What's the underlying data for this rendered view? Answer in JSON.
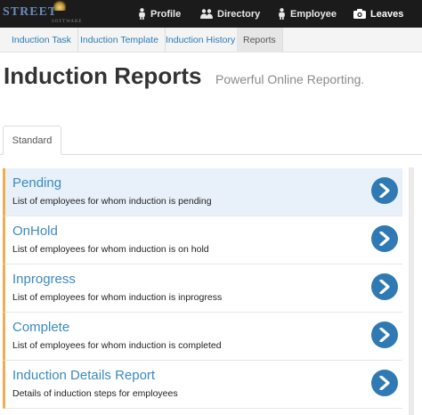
{
  "app": {
    "logo_text": "STREET",
    "logo_subtext": "SOFTWARE"
  },
  "topnav": {
    "items": [
      {
        "label": "Profile",
        "icon": "person-icon"
      },
      {
        "label": "Directory",
        "icon": "people-icon"
      },
      {
        "label": "Employee",
        "icon": "person-icon"
      },
      {
        "label": "Leaves",
        "icon": "camera-icon",
        "active": true
      }
    ]
  },
  "subnav": {
    "items": [
      {
        "label": "Induction Task"
      },
      {
        "label": "Induction Template"
      },
      {
        "label": "Induction History"
      },
      {
        "label": "Reports",
        "active": true
      }
    ]
  },
  "page": {
    "title": "Induction Reports",
    "subtitle": "Powerful Online Reporting."
  },
  "tabs": {
    "standard_label": "Standard"
  },
  "reports": [
    {
      "title": "Pending",
      "description": "List of employees for whom induction is pending",
      "highlighted": true
    },
    {
      "title": "OnHold",
      "description": "List of employees for whom induction is on hold"
    },
    {
      "title": "Inprogress",
      "description": "List of employees for whom induction is inprogress"
    },
    {
      "title": "Complete",
      "description": "List of employees for whom induction is completed"
    },
    {
      "title": "Induction Details Report",
      "description": "Details of induction steps for employees"
    }
  ],
  "colors": {
    "navbar_bg": "#1b1b1b",
    "link": "#2a7ab5",
    "report_title": "#3a8ac4",
    "accent_border": "#f0ad4e",
    "go_button": "#2f7ab4",
    "highlight_row": "#e8f1f9"
  }
}
